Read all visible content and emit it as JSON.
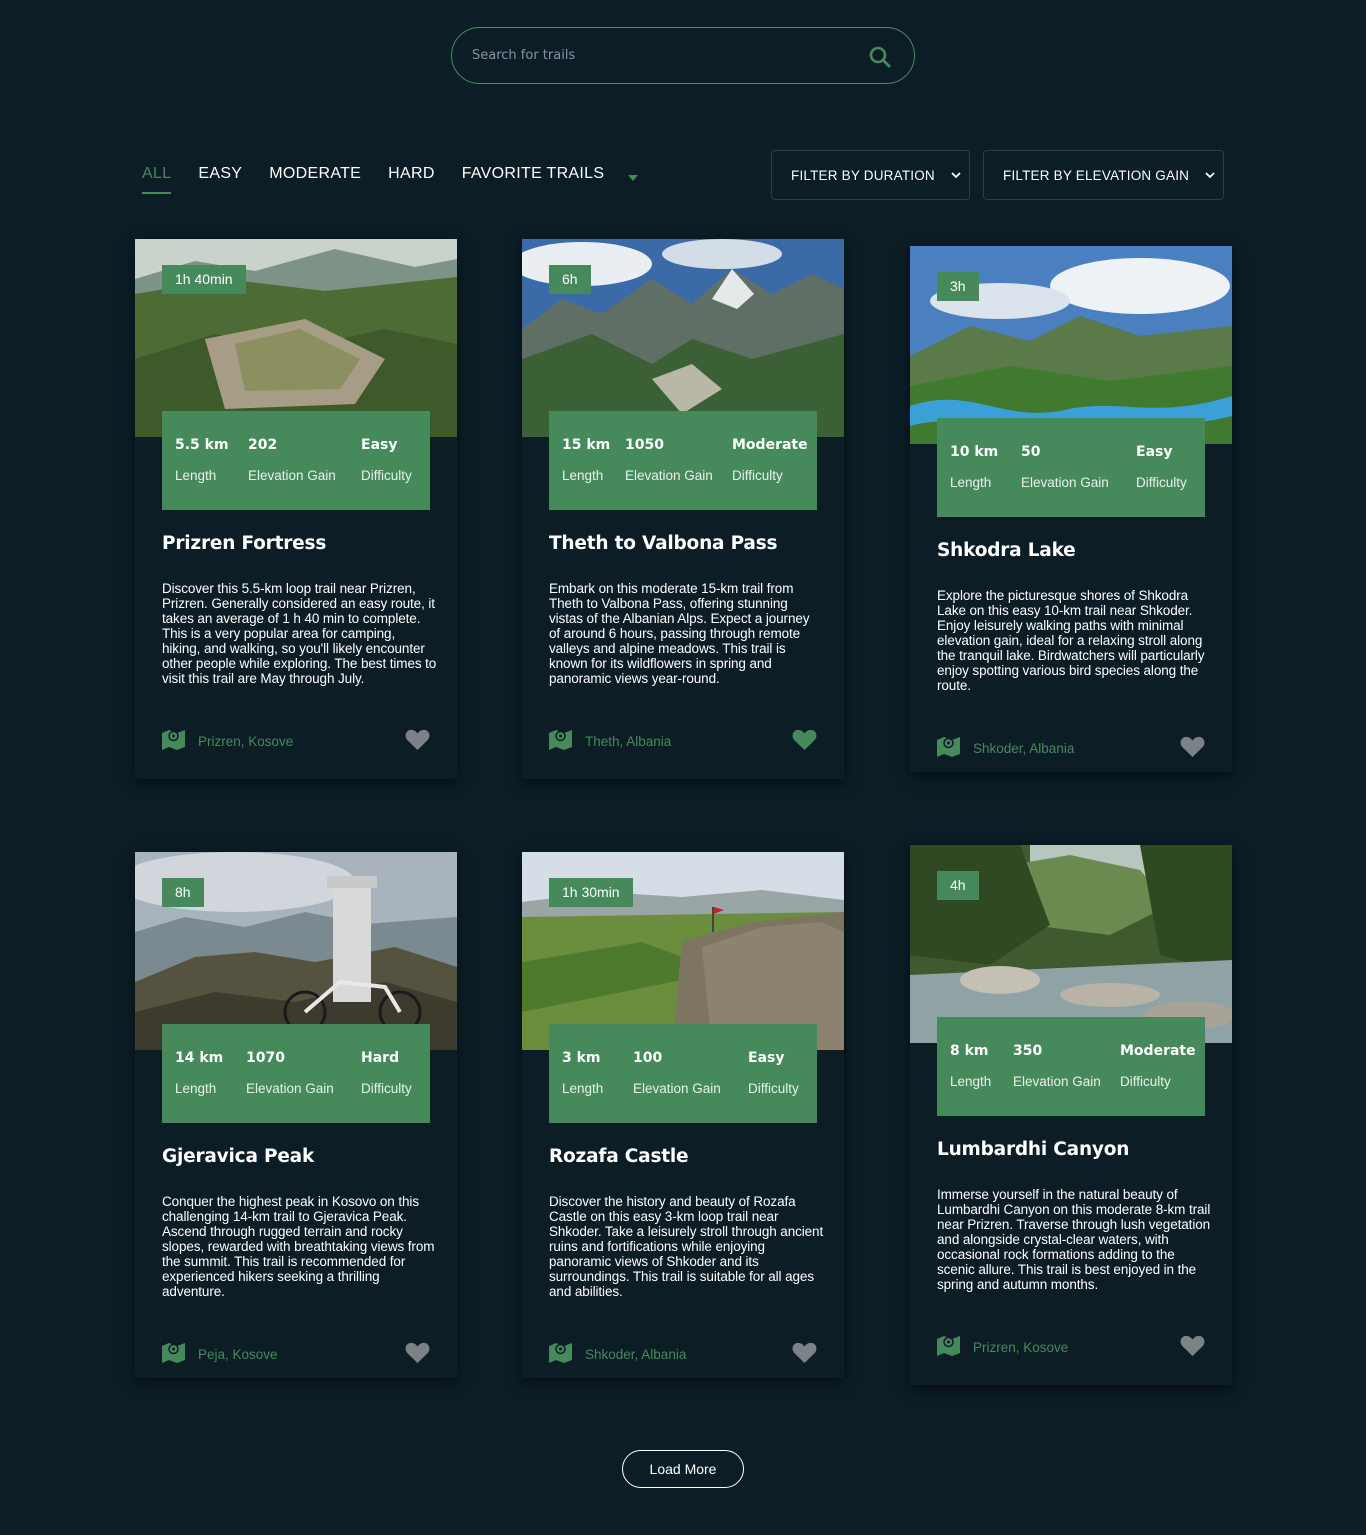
{
  "search": {
    "placeholder": "Search for trails",
    "icon": "search-icon"
  },
  "tabs": [
    {
      "label": "ALL",
      "active": true
    },
    {
      "label": "EASY",
      "active": false
    },
    {
      "label": "MODERATE",
      "active": false
    },
    {
      "label": "HARD",
      "active": false
    },
    {
      "label": "FAVORITE TRAILS",
      "active": false
    }
  ],
  "filters": {
    "duration_label": "FILTER BY DURATION",
    "elevation_label": "FILTER BY ELEVATION GAIN"
  },
  "stat_labels": {
    "length": "Length",
    "elevation": "Elevation Gain",
    "difficulty": "Difficulty"
  },
  "colors": {
    "background": "#0c1d26",
    "accent": "#468a5c",
    "heart_inactive": "#7d8287",
    "heart_active": "#468a5c"
  },
  "trails": [
    {
      "name": "Prizren Fortress",
      "duration": "1h 40min",
      "length": "5.5 km",
      "elevation": "202",
      "difficulty": "Easy",
      "description": "Discover this 5.5-km loop trail near Prizren, Prizren. Generally considered an easy route, it takes an average of 1 h 40 min to complete. This is a very popular area for camping, hiking, and walking, so you'll likely encounter other people while exploring. The best times to visit this trail are May through July.",
      "location": "Prizren, Kosove",
      "favorite": false
    },
    {
      "name": "Theth to Valbona Pass",
      "duration": "6h",
      "length": "15 km",
      "elevation": "1050",
      "difficulty": "Moderate",
      "description": "Embark on this moderate 15-km trail from Theth to Valbona Pass, offering stunning vistas of the Albanian Alps. Expect a journey of around 6 hours, passing through remote valleys and alpine meadows. This trail is known for its wildflowers in spring and panoramic views year-round.",
      "location": "Theth, Albania",
      "favorite": true
    },
    {
      "name": "Shkodra Lake",
      "duration": "3h",
      "length": "10 km",
      "elevation": "50",
      "difficulty": "Easy",
      "description": "Explore the picturesque shores of Shkodra Lake on this easy 10-km trail near Shkoder. Enjoy leisurely walking paths with minimal elevation gain, ideal for a relaxing stroll along the tranquil lake. Birdwatchers will particularly enjoy spotting various bird species along the route.",
      "location": "Shkoder, Albania",
      "favorite": false
    },
    {
      "name": "Gjeravica Peak",
      "duration": "8h",
      "length": "14 km",
      "elevation": "1070",
      "difficulty": "Hard",
      "description": "Conquer the highest peak in Kosovo on this challenging 14-km trail to Gjeravica Peak. Ascend through rugged terrain and rocky slopes, rewarded with breathtaking views from the summit. This trail is recommended for experienced hikers seeking a thrilling adventure.",
      "location": "Peja, Kosove",
      "favorite": false
    },
    {
      "name": "Rozafa Castle",
      "duration": "1h 30min",
      "length": "3 km",
      "elevation": "100",
      "difficulty": "Easy",
      "description": "Discover the history and beauty of Rozafa Castle on this easy 3-km loop trail near Shkoder. Take a leisurely stroll through ancient ruins and fortifications while enjoying panoramic views of Shkoder and its surroundings. This trail is suitable for all ages and abilities.",
      "location": "Shkoder, Albania",
      "favorite": false
    },
    {
      "name": "Lumbardhi Canyon",
      "duration": "4h",
      "length": "8 km",
      "elevation": "350",
      "difficulty": "Moderate",
      "description": "Immerse yourself in the natural beauty of Lumbardhi Canyon on this moderate 8-km trail near Prizren. Traverse through lush vegetation and alongside crystal-clear waters, with occasional rock formations adding to the scenic allure. This trail is best enjoyed in the spring and autumn months.",
      "location": "Prizren, Kosove",
      "favorite": false
    }
  ],
  "load_more": "Load More"
}
